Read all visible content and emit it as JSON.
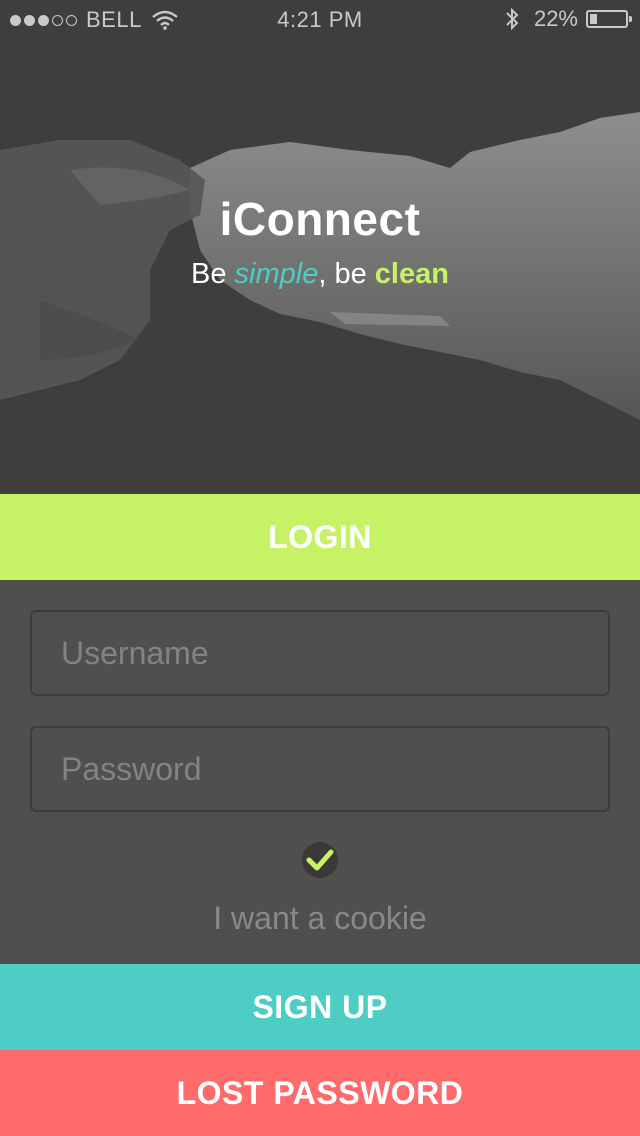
{
  "status_bar": {
    "carrier": "BELL",
    "signal_dots_filled": 3,
    "signal_dots_total": 5,
    "time": "4:21 PM",
    "battery_percent": "22%",
    "icons": [
      "signal-dots-icon",
      "wifi-icon",
      "bluetooth-icon",
      "battery-icon"
    ]
  },
  "hero": {
    "app_name": "iConnect",
    "tagline": {
      "be1": "Be ",
      "simple": "simple",
      "sep": ", be ",
      "clean": "clean"
    }
  },
  "login": {
    "label": "LOGIN",
    "username_placeholder": "Username",
    "password_placeholder": "Password",
    "cookie_label": "I want a cookie",
    "cookie_checked": true
  },
  "actions": {
    "signup_label": "SIGN UP",
    "lost_password_label": "LOST PASSWORD"
  },
  "colors": {
    "accent_green": "#c8f266",
    "accent_teal": "#4ecdc4",
    "accent_red": "#ff6b6b",
    "background": "#504f4d"
  }
}
